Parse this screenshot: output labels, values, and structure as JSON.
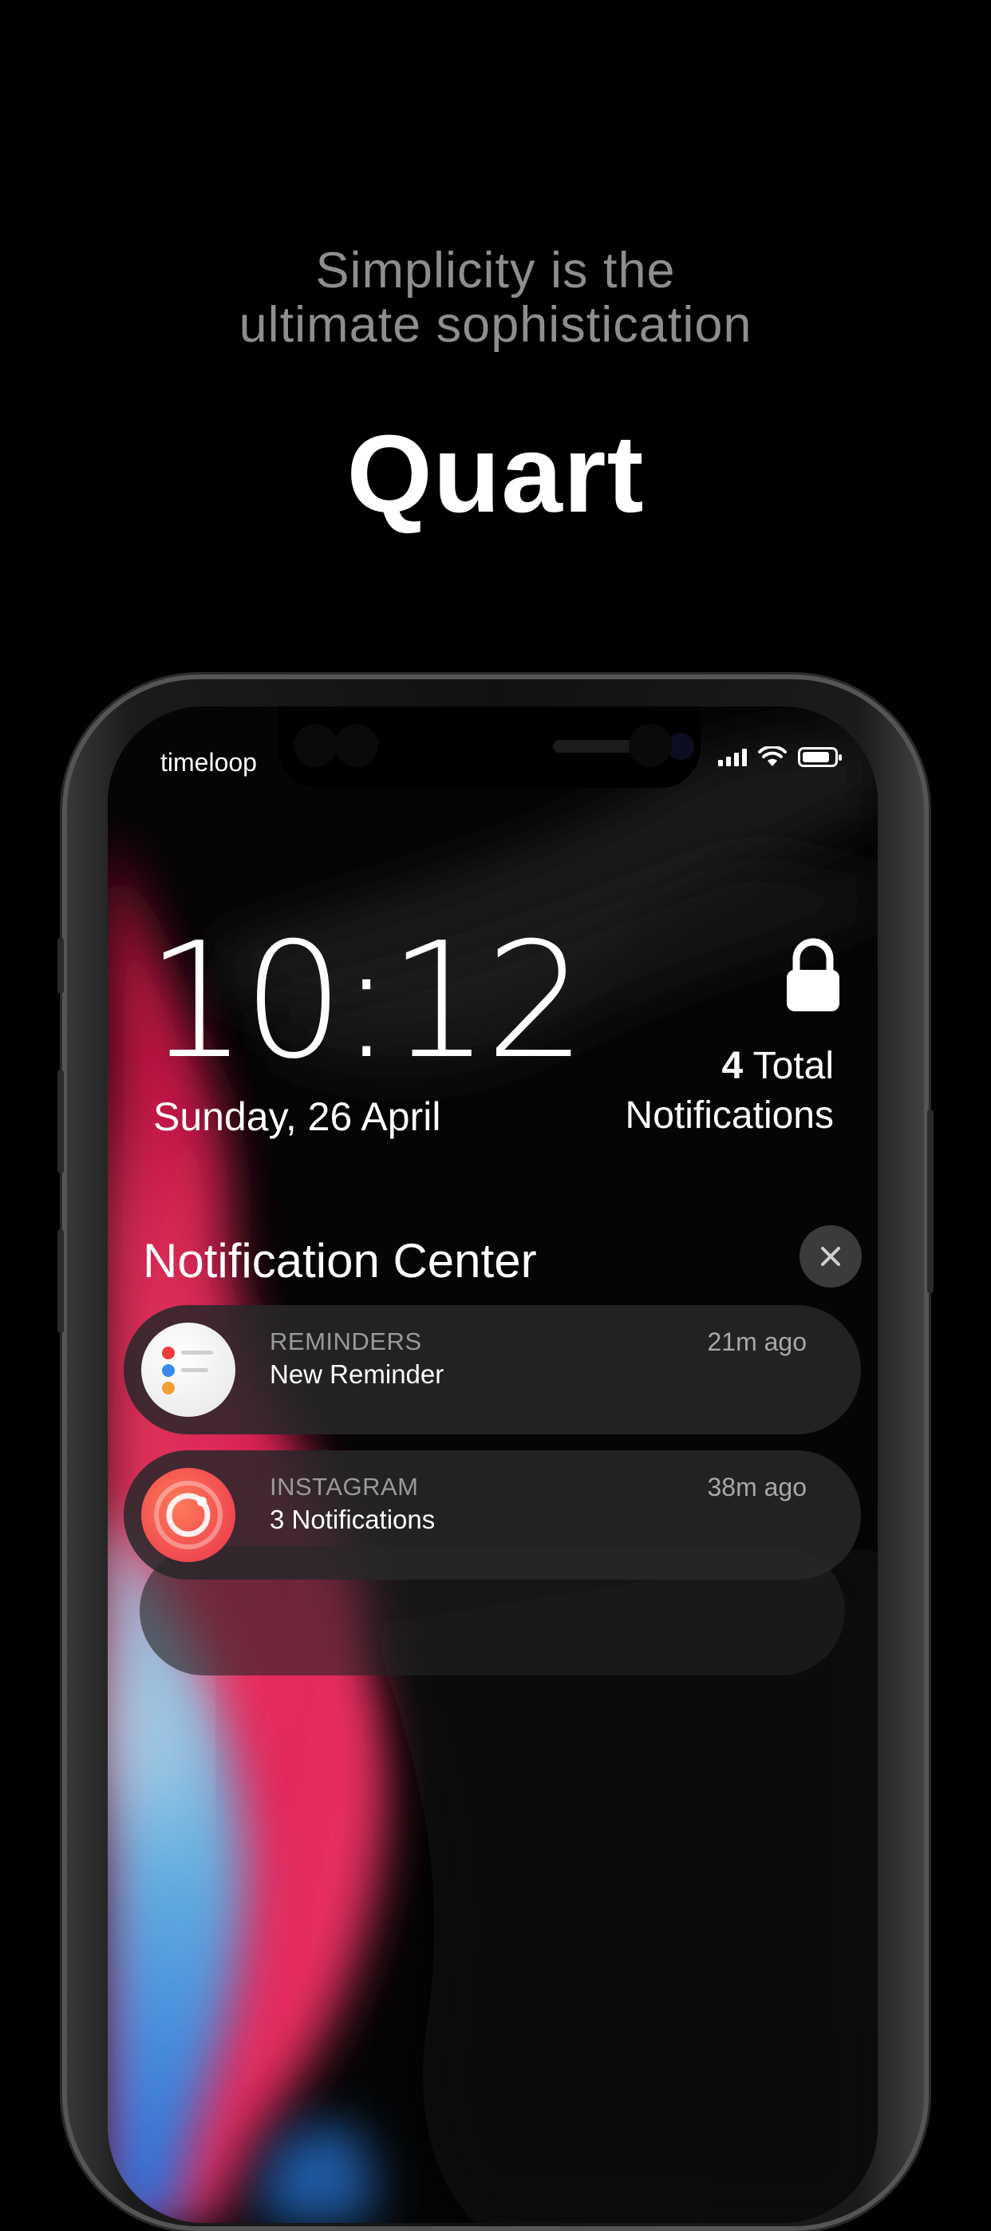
{
  "tagline": {
    "line1": "Simplicity is the",
    "line2": "ultimate sophistication"
  },
  "brand": "Quart",
  "status_bar": {
    "carrier": "timeloop"
  },
  "lock_screen": {
    "time": "10:12",
    "date": "Sunday, 26 April",
    "total_count": "4",
    "total_word": "Total",
    "total_label": "Notifications"
  },
  "notification_center": {
    "title": "Notification Center",
    "notifications": [
      {
        "app": "REMINDERS",
        "message": "New Reminder",
        "time": "21m ago",
        "icon": "reminders-icon"
      },
      {
        "app": "INSTAGRAM",
        "message": "3 Notifications",
        "time": "38m ago",
        "icon": "instagram-icon"
      }
    ]
  },
  "colors": {
    "background": "#000000",
    "accent_pink": "#e8245a",
    "card": "#28282a"
  }
}
